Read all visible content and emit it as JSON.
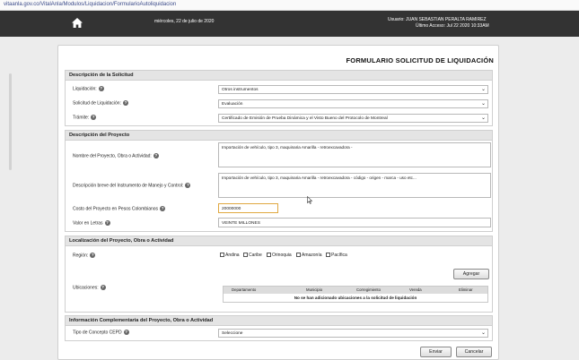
{
  "browser": {
    "url": "vitaanla.gov.co/VitalAnla/Modulos/Liquidacion/FormularioAutoliquidacion"
  },
  "header": {
    "date": "miércoles, 22 de julio de 2020",
    "user_line": "Usuario: JUAN SEBASTIAN PERALTA RAMIREZ",
    "last_access": "Último Acceso: Jul 22 2020 10:33AM"
  },
  "form": {
    "title": "FORMULARIO SOLICITUD DE LIQUIDACIÓN"
  },
  "solicitud": {
    "heading": "Descripción de la Solicitud",
    "liquidacion_label": "Liquidación:",
    "liquidacion_value": "Otros instrumentos",
    "solicitud_label": "Solicitud de Liquidación:",
    "solicitud_value": "Evaluación",
    "tramite_label": "Trámite:",
    "tramite_value": "Certificado de Emisión de Prueba Dinámica y el Visto Bueno del Protocolo de Montreal"
  },
  "proyecto": {
    "heading": "Descripción del Proyecto",
    "nombre_label": "Nombre del Proyecto, Obra o Actividad:",
    "nombre_value": "Importación de vehículo, tipo 3, maquinaria Amarilla - retroexcavadora -",
    "descripcion_label": "Descripción breve del Instrumento de Manejo y Control:",
    "descripcion_value": "Importación de vehículo, tipo 3, maquinaria Amarilla - retroexcavadora - código - origen - marca - uso etc...",
    "costo_label": "Costo del Proyecto en Pesos Colombianos",
    "costo_value": "20000000",
    "valor_label": "Valor en Letras",
    "valor_value": "VEINTE MILLONES"
  },
  "localizacion": {
    "heading": "Localización del Proyecto, Obra o Actividad",
    "region_label": "Región:",
    "regions": [
      "Andina",
      "Caribe",
      "Orinoquia",
      "Amazonía",
      "Pacífica"
    ],
    "ubicaciones_label": "Ubicaciones:",
    "add_button": "Agregar",
    "columns": [
      "Departamento",
      "Municipio",
      "Corregimiento",
      "Vereda",
      "Eliminar"
    ],
    "empty_message": "No se han adicionado ubicaciones a la solicitud de liquidación"
  },
  "complementaria": {
    "heading": "Información Complementaria del Proyecto, Obra o Actividad",
    "tipo_label": "Tipo de Concepto CEPD",
    "tipo_value": "Seleccione"
  },
  "actions": {
    "send": "Enviar",
    "cancel": "Cancelar"
  },
  "icons": {
    "home": "home-icon",
    "help": "help-icon",
    "dropdown": "chevron-down-icon"
  },
  "colors": {
    "header_bg": "#333333",
    "section_header_bg": "#e4e4e4",
    "highlight_border": "#e0a840"
  }
}
